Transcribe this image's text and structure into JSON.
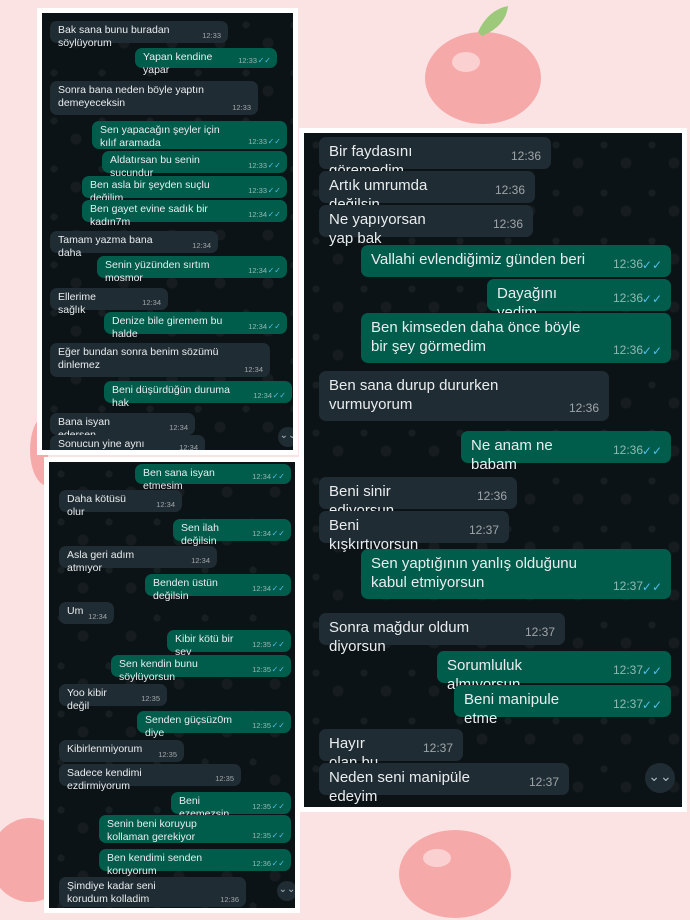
{
  "panel_top_left": {
    "messages": [
      {
        "dir": "in",
        "text": "Bak sana bunu buradan söylüyorum",
        "time": "12:33"
      },
      {
        "dir": "out",
        "text": "Yapan kendine yapar",
        "time": "12:33"
      },
      {
        "dir": "in",
        "text": "Sonra bana neden böyle yaptın demeyeceksin",
        "time": "12:33"
      },
      {
        "dir": "out",
        "text": "Sen yapacağın şeyler için kılıf aramada",
        "time": "12:33"
      },
      {
        "dir": "out",
        "text": "Aldatırsan bu senin suçundur",
        "time": "12:33"
      },
      {
        "dir": "out",
        "text": "Ben asla bir şeyden suçlu değilim",
        "time": "12:33"
      },
      {
        "dir": "out",
        "text": "Ben gayet evine sadık bir kadın7m",
        "time": "12:34"
      },
      {
        "dir": "in",
        "text": "Tamam yazma bana daha",
        "time": "12:34"
      },
      {
        "dir": "out",
        "text": "Senin yüzünden sırtım mosmor",
        "time": "12:34"
      },
      {
        "dir": "in",
        "text": "Ellerime sağlık",
        "time": "12:34"
      },
      {
        "dir": "out",
        "text": "Denize bile giremem bu halde",
        "time": "12:34"
      },
      {
        "dir": "in",
        "text": "Eğer bundan sonra benim sözümü dinlemez",
        "time": "12:34"
      },
      {
        "dir": "out",
        "text": "Beni düşürdüğün duruma hak",
        "time": "12:34"
      },
      {
        "dir": "in",
        "text": "Bana isyan edersen",
        "time": "12:34"
      },
      {
        "dir": "in",
        "text": "Sonucun yine aynı olur",
        "time": "12:34"
      }
    ]
  },
  "panel_bottom_left": {
    "messages": [
      {
        "dir": "out",
        "text": "Ben sana isyan etmesim",
        "time": "12:34"
      },
      {
        "dir": "in",
        "text": "Daha kötüsü olur",
        "time": "12:34"
      },
      {
        "dir": "out",
        "text": "Sen ilah değilsin",
        "time": "12:34"
      },
      {
        "dir": "in",
        "text": "Asla geri adım atmıyor",
        "time": "12:34"
      },
      {
        "dir": "out",
        "text": "Benden üstün değilsin",
        "time": "12:34"
      },
      {
        "dir": "in",
        "text": "Um",
        "time": "12:34"
      },
      {
        "dir": "out",
        "text": "Kibir kötü bir şey",
        "time": "12:35"
      },
      {
        "dir": "out",
        "text": "Sen kendin bunu söylüyorsun",
        "time": "12:35"
      },
      {
        "dir": "in",
        "text": "Yoo kibir değil",
        "time": "12:35"
      },
      {
        "dir": "out",
        "text": "Senden güçsüz0m diye",
        "time": "12:35"
      },
      {
        "dir": "in",
        "text": "Kibirlenmiyorum",
        "time": "12:35"
      },
      {
        "dir": "in",
        "text": "Sadece kendimi ezdirmiyorum",
        "time": "12:35"
      },
      {
        "dir": "out",
        "text": "Beni ezemezsin",
        "time": "12:35"
      },
      {
        "dir": "out",
        "text": "Senin beni koruyup kollaman gerekiyor",
        "time": "12:35"
      },
      {
        "dir": "out",
        "text": "Ben kendimi senden koruyorum",
        "time": "12:36"
      },
      {
        "dir": "in",
        "text": "Şimdiye kadar seni korudum kolladim",
        "time": "12:36"
      }
    ]
  },
  "panel_right": {
    "messages": [
      {
        "dir": "in",
        "text": "Bir faydasını göremedim",
        "time": "12:36"
      },
      {
        "dir": "in",
        "text": "Artık umrumda değilsin",
        "time": "12:36"
      },
      {
        "dir": "in",
        "text": "Ne yapıyorsan yap bak",
        "time": "12:36"
      },
      {
        "dir": "out",
        "text": "Vallahi evlendiğimiz günden beri",
        "time": "12:36"
      },
      {
        "dir": "out",
        "text": "Dayağını yedim",
        "time": "12:36"
      },
      {
        "dir": "out",
        "text": "Ben kimseden daha önce böyle bir şey görmedim",
        "time": "12:36"
      },
      {
        "dir": "in",
        "text": "Ben sana durup dururken vurmuyorum",
        "time": "12:36"
      },
      {
        "dir": "out",
        "text": "Ne anam ne babam",
        "time": "12:36"
      },
      {
        "dir": "in",
        "text": "Beni sinir ediyorsun",
        "time": "12:36"
      },
      {
        "dir": "in",
        "text": "Beni kışkırtıyorsun",
        "time": "12:37"
      },
      {
        "dir": "out",
        "text": "Sen yaptığının yanlış olduğunu kabul etmiyorsun",
        "time": "12:37"
      },
      {
        "dir": "in",
        "text": "Sonra mağdur oldum diyorsun",
        "time": "12:37"
      },
      {
        "dir": "out",
        "text": "Sorumluluk almıyorsun",
        "time": "12:37"
      },
      {
        "dir": "out",
        "text": "Beni manipule etme",
        "time": "12:37"
      },
      {
        "dir": "in",
        "text": "Hayır olan bu",
        "time": "12:37"
      },
      {
        "dir": "in",
        "text": "Neden seni manipüle edeyim",
        "time": "12:37"
      }
    ]
  },
  "icons": {
    "read_ticks": "✓✓",
    "scroll_down": "⌄⌄"
  },
  "colors": {
    "incoming": "#202c33",
    "outgoing": "#005c4b",
    "ticks": "#53bdeb",
    "chat_bg": "#0c1317"
  }
}
